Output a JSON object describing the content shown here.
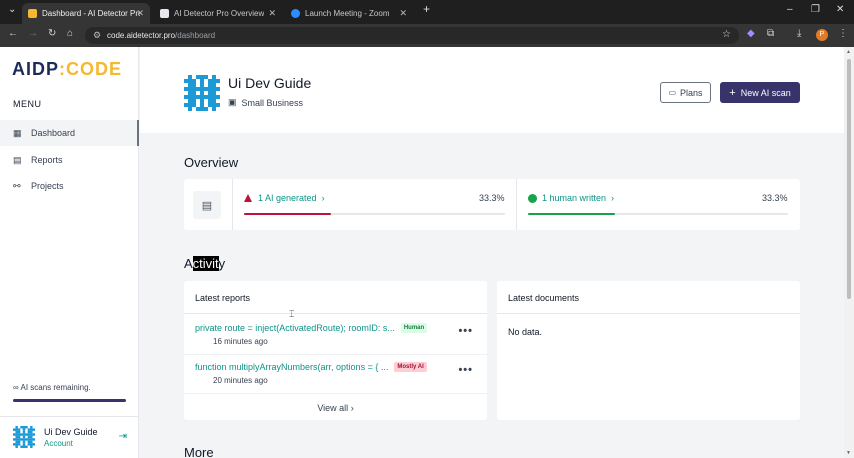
{
  "browser": {
    "tabs": [
      {
        "title": "Dashboard - AI Detector Pro Co",
        "active": true
      },
      {
        "title": "AI Detector Pro Overview",
        "active": false
      },
      {
        "title": "Launch Meeting - Zoom",
        "active": false
      }
    ],
    "url_host": "code.aidetector.pro",
    "url_path": "/dashboard",
    "profile_initial": "P"
  },
  "sidebar": {
    "logo_part1": "AIDP",
    "logo_sep": ":",
    "logo_part2": "CODE",
    "menu_title": "MENU",
    "items": [
      {
        "label": "Dashboard",
        "icon": "grid-icon",
        "active": true
      },
      {
        "label": "Reports",
        "icon": "report-icon",
        "active": false
      },
      {
        "label": "Projects",
        "icon": "projects-icon",
        "active": false
      }
    ],
    "scans_remaining": "∞ AI scans remaining.",
    "scans_fill": 1.0,
    "account_name": "Ui Dev Guide",
    "account_sub": "Account"
  },
  "header": {
    "title": "Ui Dev Guide",
    "subtitle": "Small Business",
    "plans_label": "Plans",
    "new_scan_label": "New AI scan"
  },
  "overview": {
    "title": "Overview",
    "ai_label": "1 AI generated",
    "ai_pct": "33.3%",
    "ai_fill": 0.333,
    "human_label": "1 human written",
    "human_pct": "33.3%",
    "human_fill": 0.333
  },
  "activity": {
    "title_prefix": "A",
    "title_highlight": "ctivit",
    "title_suffix": "y",
    "latest_reports_title": "Latest reports",
    "reports": [
      {
        "text": "private route = inject(ActivatedRoute); roomID: s...",
        "badge": "Human",
        "badge_type": "human",
        "time": "16 minutes ago"
      },
      {
        "text": "function multiplyArrayNumbers(arr, options = { ...",
        "badge": "Mostly AI",
        "badge_type": "ai",
        "time": "20 minutes ago"
      }
    ],
    "view_all": "View all",
    "latest_documents_title": "Latest documents",
    "no_data": "No data."
  },
  "more_title": "More",
  "colors": {
    "brand_dark": "#38336a",
    "accent_teal": "#0d9488",
    "ai_red": "#be123c",
    "human_green": "#16a34a"
  }
}
